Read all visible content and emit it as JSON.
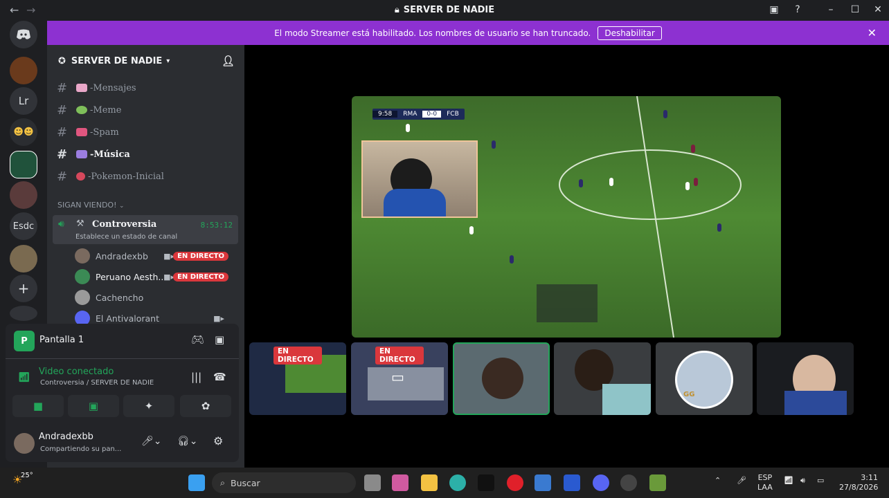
{
  "window": {
    "title": "SERVER DE NADIE",
    "back": "←",
    "forward": "→"
  },
  "banner": {
    "text": "El modo Streamer está habilitado. Los nombres de usuario se han truncado.",
    "button": "Deshabilitar",
    "close": "✕"
  },
  "rail": {
    "servers": [
      "Lr",
      "Esdc"
    ],
    "add": "+"
  },
  "server": {
    "name": "SERVER DE NADIE"
  },
  "channels": [
    {
      "name": "-Mensajes",
      "emoji_color": "#e9a7c8"
    },
    {
      "name": "-Meme",
      "emoji_color": "#7fbf5a"
    },
    {
      "name": "-Spam",
      "emoji_color": "#e0567f"
    },
    {
      "name": "-Música",
      "emoji_color": "#9b7de0",
      "unread": true
    },
    {
      "name": "-Pokemon-Inicial",
      "emoji_color": "#d6485c"
    }
  ],
  "category": "SIGAN VIENDO!",
  "voice_channel": {
    "name": "Controversia",
    "time": "8:53:12",
    "status": "Establece un estado de canal"
  },
  "voice_users": [
    {
      "name": "Andradexbb",
      "live": "EN DIRECTO",
      "avatar_color": "#7a6a5f"
    },
    {
      "name": "Peruano Aesth...",
      "live": "EN DIRECTO",
      "avatar_color": "#3b8a55"
    },
    {
      "name": "Cachencho",
      "live": "",
      "avatar_color": "#9a9a9a"
    },
    {
      "name": "El Antivalorant",
      "live": "",
      "avatar_color": "#5865f2"
    }
  ],
  "screen_share": {
    "label": "Pantalla 1"
  },
  "connection": {
    "status": "Video conectado",
    "location": "Controversia / SERVER DE NADIE"
  },
  "user": {
    "name": "Andradexbb",
    "status": "Compartiendo su pan..."
  },
  "game": {
    "clock": "9:58",
    "home": "RMA",
    "score": "0-0",
    "away": "FCB"
  },
  "tiles": [
    {
      "live": "EN DIRECTO",
      "bg": "#1f2a44"
    },
    {
      "live": "EN DIRECTO",
      "bg": "#39415e"
    },
    {
      "live": "",
      "bg": "#5b6a70"
    },
    {
      "live": "",
      "bg": "#3a3d40"
    },
    {
      "live": "",
      "bg": "#b9c8d8",
      "label": "GG"
    },
    {
      "live": "",
      "bg": "#1a1c20"
    }
  ],
  "taskbar": {
    "weather": "25°",
    "search": "Buscar",
    "lang1": "ESP",
    "lang2": "LAA",
    "time": "3:11",
    "date": "27/8/2026"
  },
  "colors": {
    "accent": "#8d31d1",
    "live": "#da373c",
    "connected": "#23a55a"
  }
}
